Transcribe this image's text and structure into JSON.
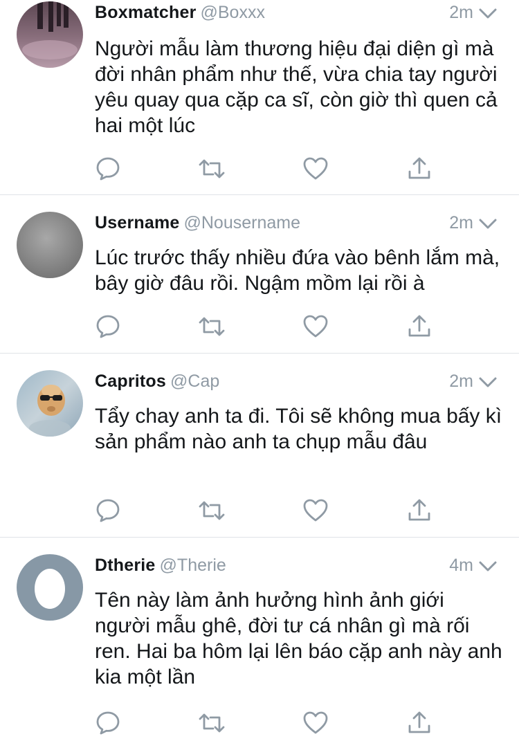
{
  "tweets": [
    {
      "name": "Boxmatcher",
      "handle": "@Boxxx",
      "time": "2m",
      "text": "Người mẫu làm thương hiệu đại diện gì mà đời nhân phẩm như thế, vừa chia tay người yêu quay qua cặp ca sĩ, còn giờ thì quen cả hai một lúc",
      "avatar": "photo-avatar-dark"
    },
    {
      "name": "Username",
      "handle": "@Nousername",
      "time": "2m",
      "text": "Lúc trước thấy nhiều đứa vào bênh lắm mà, bây giờ đâu rồi. Ngậm mồm lại rồi à",
      "avatar": "grey-avatar"
    },
    {
      "name": "Capritos",
      "handle": "@Cap",
      "time": "2m",
      "text": "Tẩy chay anh ta đi. Tôi sẽ không mua bấy kì sản phẩm nào anh ta chụp mẫu đâu",
      "avatar": "cat-sunglasses-avatar"
    },
    {
      "name": "Dtherie",
      "handle": "@Therie",
      "time": "4m",
      "text": "Tên này làm ảnh hưởng hình ảnh giới người mẫu ghê, đời tư cá nhân gì mà rối ren. Hai ba hôm lại lên báo cặp anh này anh kia một lần",
      "avatar": "default-egg-avatar"
    }
  ],
  "icons": {
    "reply": "reply-icon",
    "retweet": "retweet-icon",
    "like": "heart-icon",
    "share": "share-icon",
    "menu": "chevron-down-icon"
  },
  "colors": {
    "text": "#14171a",
    "secondary": "#8f9aa4",
    "divider": "#dfe3e7",
    "default_avatar_bg": "#8798a6"
  }
}
